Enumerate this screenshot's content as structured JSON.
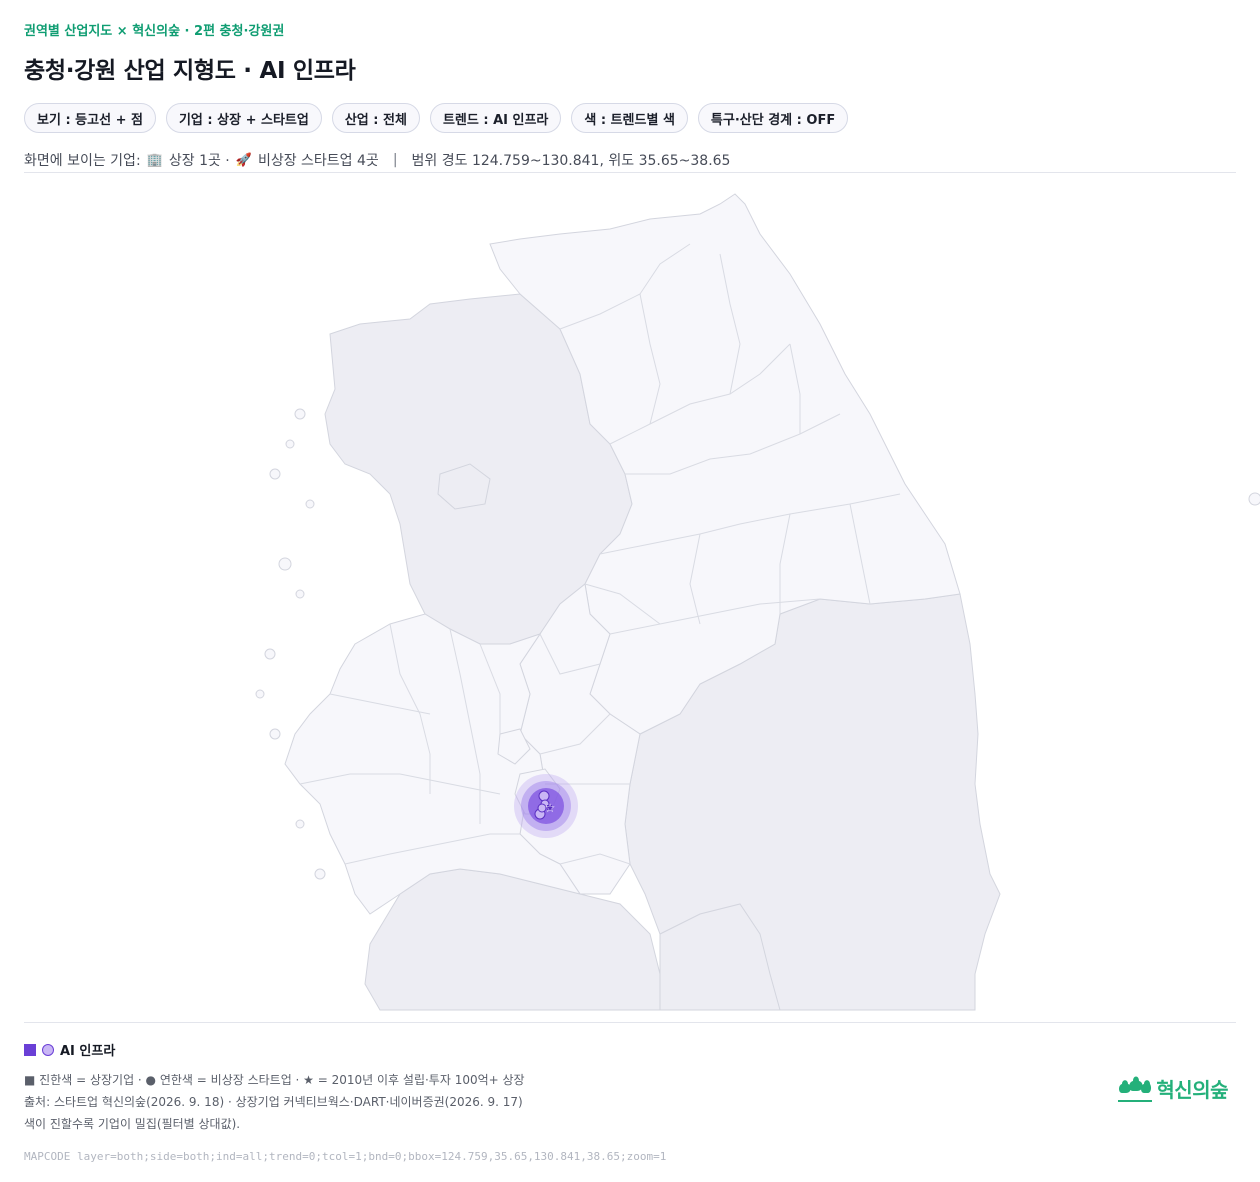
{
  "header": {
    "eyebrow": "권역별 산업지도 × 혁신의숲 · 2편 충청·강원권",
    "title": "충청·강원 산업 지형도 · AI 인프라"
  },
  "chips": [
    "보기 : 등고선 + 점",
    "기업 : 상장 + 스타트업",
    "산업 : 전체",
    "트렌드 : AI 인프라",
    "색 : 트렌드별 색",
    "특구·산단 경계 : OFF"
  ],
  "summary": {
    "prefix": "화면에 보이는 기업:",
    "listed_icon": "🏢",
    "listed": "상장 1곳 ·",
    "startup_icon": "🚀",
    "startup": "비상장 스타트업 4곳",
    "separator": "|",
    "range": "범위 경도 124.759~130.841, 위도 35.65~38.65"
  },
  "map": {
    "highlight_color": "#7b4fe0",
    "region_fill": "#f7f7fb",
    "outside_fill": "#ededf3",
    "border_color": "#d3d5de",
    "markers": 5
  },
  "legend": {
    "trend_label": "AI 인프라",
    "trend_color": "#6a3fd6",
    "notes": [
      "■ 진한색 = 상장기업 · ● 연한색 = 비상장 스타트업 · ★ = 2010년 이후 설립·투자 100억+ 상장",
      "출처: 스타트업 혁신의숲(2026. 9. 18) · 상장기업 커넥티브웍스·DART·네이버증권(2026. 9. 17)",
      "색이 진할수록 기업이 밀집(필터별 상대값)."
    ]
  },
  "mapcode": "MAPCODE layer=both;side=both;ind=all;trend=0;tcol=1;bnd=0;bbox=124.759,35.65,130.841,38.65;zoom=1",
  "brand": {
    "name": "혁신의숲",
    "color": "#24b07a"
  }
}
